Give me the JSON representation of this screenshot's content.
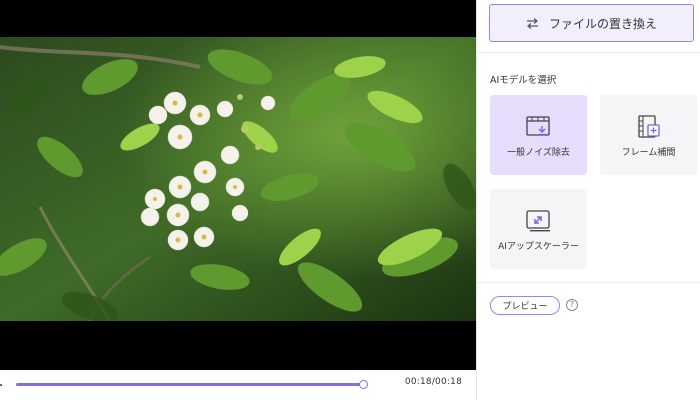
{
  "player": {
    "time_display": "00:18/00:18",
    "progress": 1.0
  },
  "panel": {
    "replace_file_label": "ファイルの置き換え",
    "section_label": "AIモデルを選択",
    "models": [
      {
        "label": "一般ノイズ除去",
        "icon": "film-denoise-icon",
        "selected": true
      },
      {
        "label": "フレーム補間",
        "icon": "film-add-frame-icon",
        "selected": false
      },
      {
        "label": "AIアップスケーラー",
        "icon": "upscale-icon",
        "selected": false
      }
    ],
    "preview_label": "プレビュー",
    "help_icon": "question-mark-icon"
  },
  "colors": {
    "accent": "#8a6ee0",
    "accent_border": "#9c84ea",
    "selected_card": "#e6dcfb",
    "card": "#f5f5f7",
    "button_bg": "#f2eefd"
  }
}
